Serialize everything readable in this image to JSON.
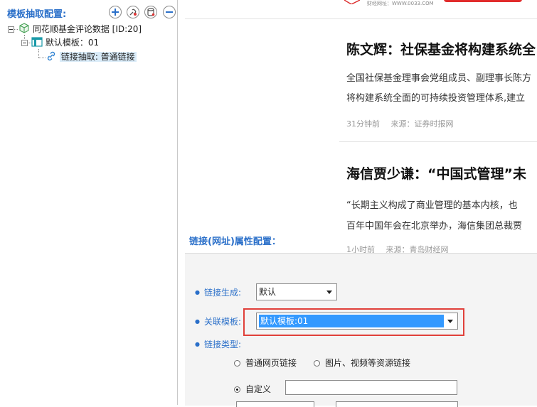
{
  "left_panel": {
    "title": "模板抽取配置:",
    "tree": {
      "root": "同花顺基金评论数据 [ID:20]",
      "template": "默认模板：01",
      "link": "链接抽取: 普通链接"
    }
  },
  "news": {
    "site_text": "财经网址：WWW.0033.COM",
    "items": [
      {
        "title": "陈文辉：社保基金将构建系统全",
        "line1": "全国社保基金理事会党组成员、副理事长陈方",
        "line2": "将构建系统全面的可持续投资管理体系,建立",
        "time": "31分钟前",
        "source": "来源：证券时报网"
      },
      {
        "title": "海信贾少谦：“中国式管理”未",
        "line1": "“长期主义构成了商业管理的基本内核，也",
        "line2": "百年中国年会在北京举办，海信集团总裁贾",
        "time": "1小时前",
        "source": "来源：青岛财经网"
      }
    ]
  },
  "props": {
    "title": "链接(网址)属性配置：",
    "gen_label": "链接生成:",
    "gen_value": "默认",
    "rel_label": "关联模板:",
    "rel_value": "默认模板:01",
    "type_label": "链接类型:",
    "radio_normal": "普通网页链接",
    "radio_media": "图片、视频等资源链接",
    "radio_custom": "自定义",
    "custom_value": ""
  }
}
